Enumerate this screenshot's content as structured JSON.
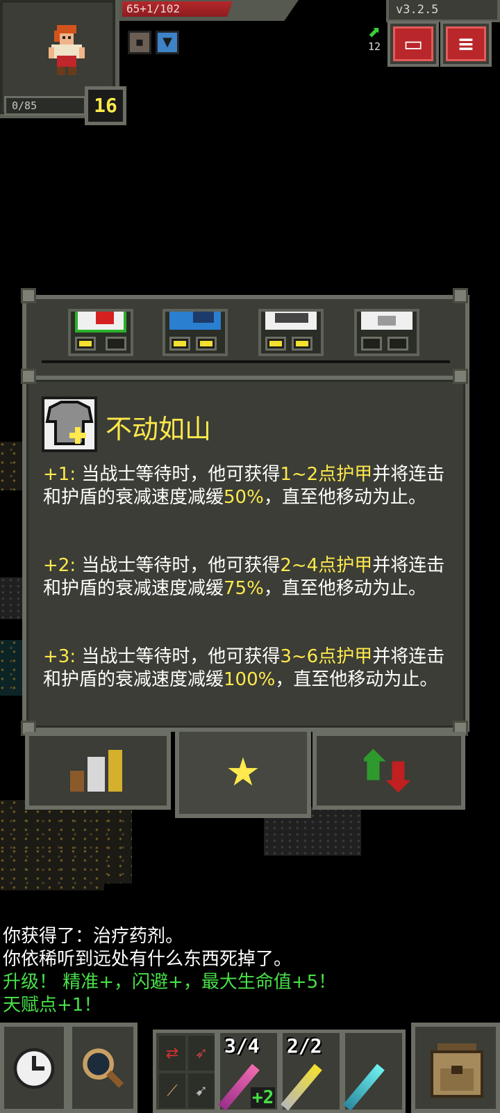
{
  "status": {
    "hp_text": "65+1/102",
    "hp_fraction": 0.64,
    "xp_text": "0/85",
    "level": "16",
    "buffs": [
      "hunger-status-icon",
      "shield-status-icon"
    ]
  },
  "topbar": {
    "version": "v3.2.5",
    "depth": "12",
    "journal_icon": "journal-icon",
    "menu_icon": "menu-icon"
  },
  "talent_panel": {
    "tiers": [
      {
        "icon": "heart-talent-icon",
        "points": 2,
        "max": 3
      },
      {
        "icon": "hammer-talent-icon",
        "points": 2,
        "max": 3
      },
      {
        "icon": "eye-talent-icon",
        "points": 2,
        "max": 3
      },
      {
        "icon": "armor-talent-icon",
        "points": 0,
        "max": 3
      }
    ],
    "selected": {
      "title": "不动如山",
      "icon": "armor-upgrade-icon",
      "levels": [
        {
          "prefix": "+1:",
          "text_a": " 当战士等待时，他可获得",
          "hl_a": "1~2点护甲",
          "text_b": "并将连击和护盾的衰减速度减缓",
          "hl_b": "50%",
          "text_c": "，直至他移动为止。"
        },
        {
          "prefix": "+2:",
          "text_a": " 当战士等待时，他可获得",
          "hl_a": "2~4点护甲",
          "text_b": "并将连击和护盾的衰减速度减缓",
          "hl_b": "75%",
          "text_c": "，直至他移动为止。"
        },
        {
          "prefix": "+3:",
          "text_a": " 当战士等待时，他可获得",
          "hl_a": "3~6点护甲",
          "text_b": "并将连击和护盾的衰减速度减缓",
          "hl_b": "100%",
          "text_c": "，直至他移动为止。"
        }
      ]
    },
    "tabs": [
      {
        "icon": "stats-bars-icon",
        "active": false
      },
      {
        "icon": "star-icon",
        "active": true
      },
      {
        "icon": "swap-arrows-icon",
        "active": false
      }
    ]
  },
  "log": [
    {
      "text": "你获得了：治疗药剂。",
      "color": "white"
    },
    {
      "text": "你依稀听到远处有什么东西死掉了。",
      "color": "white"
    },
    {
      "text": "升级！ 精准+，闪避+，最大生命值+5！",
      "color": "green"
    },
    {
      "text": "天赋点+1！",
      "color": "green"
    }
  ],
  "toolbar": {
    "wait_icon": "clock-icon",
    "search_icon": "magnifier-icon",
    "quickslots": [
      {
        "count": "3/4",
        "bonus": "+2",
        "icon": "wand-pink-icon"
      },
      {
        "count": "2/2",
        "bonus": "",
        "icon": "wand-gold-icon"
      },
      {
        "count": "",
        "bonus": "",
        "icon": "wand-cyan-icon"
      }
    ],
    "backpack_icon": "backpack-icon"
  },
  "colors": {
    "panel": "#3b3d36",
    "frame": "#6b6e64",
    "highlight": "#ffe94d",
    "log_green": "#48e048",
    "hp_red": "#b4282b"
  }
}
